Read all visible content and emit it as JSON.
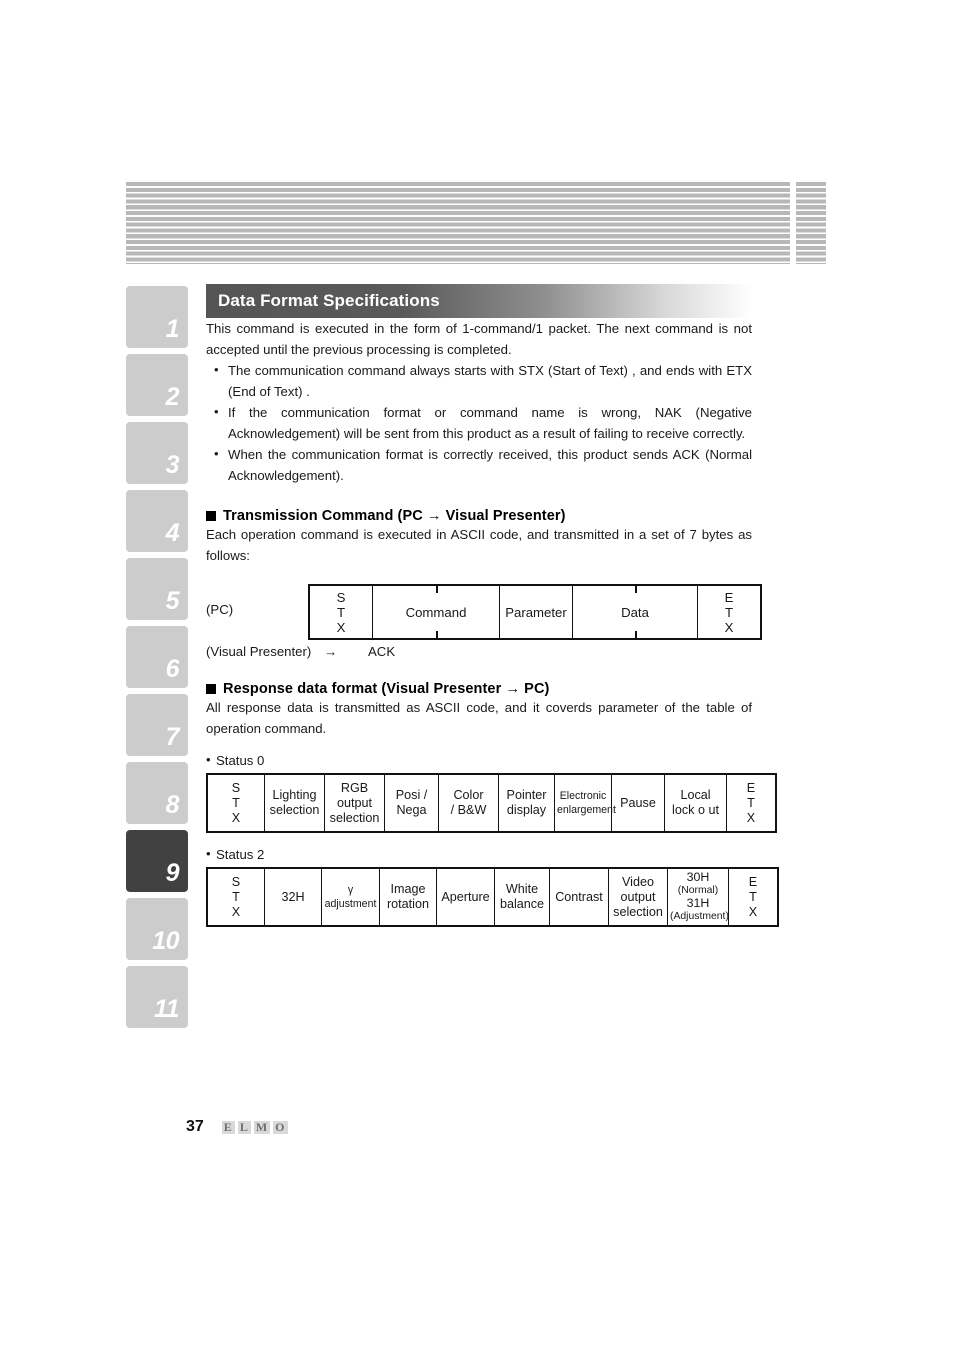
{
  "page": {
    "number": "37",
    "logo_letters": [
      "E",
      "L",
      "M",
      "O"
    ]
  },
  "tab_rail": {
    "active": "9",
    "tabs": [
      "1",
      "2",
      "3",
      "4",
      "5",
      "6",
      "7",
      "8",
      "9",
      "10",
      "11"
    ]
  },
  "section": {
    "title": "Data Format Specifications"
  },
  "intro": {
    "paragraph": "This command is executed in the form of 1-command/1 packet.  The next command is not accepted until the previous processing is completed.",
    "bullets": [
      "The communication command always starts with STX (Start of Text) , and ends with ETX (End of Text) .",
      "If the communication format or command name is wrong, NAK (Negative Acknowledgement) will be sent from this product as a result of failing to receive correctly.",
      "When the communication format is correctly received, this product sends ACK (Normal Acknowledgement)."
    ]
  },
  "transmission": {
    "heading": "Transmission Command (PC → Visual Presenter)",
    "description": "Each operation command is executed in ASCII code, and transmitted in a set of 7 bytes as follows:",
    "pc_label": "(PC)",
    "table_cells": [
      {
        "lines": [
          "S",
          "T",
          "X"
        ],
        "split": false
      },
      {
        "lines": [
          "Command"
        ],
        "split": true
      },
      {
        "lines": [
          "Parameter"
        ],
        "split": false
      },
      {
        "lines": [
          "Data"
        ],
        "split": true
      },
      {
        "lines": [
          "E",
          "T",
          "X"
        ],
        "split": false
      }
    ],
    "ack_row": {
      "source": "(Visual Presenter)",
      "arrow": "→",
      "value": "ACK"
    }
  },
  "response": {
    "heading": "Response data format (Visual Presenter → PC)",
    "description": "All response data is transmitted as ASCII code, and it coverds parameter of the table of operation command.",
    "status0": {
      "label": "Status 0",
      "cells": [
        {
          "lines": [
            "S",
            "T",
            "X"
          ],
          "size": "normal"
        },
        {
          "lines": [
            "Lighting",
            "selection"
          ],
          "size": "normal"
        },
        {
          "lines": [
            "RGB",
            "output",
            "selection"
          ],
          "size": "normal"
        },
        {
          "lines": [
            "Posi /",
            "Nega"
          ],
          "size": "normal"
        },
        {
          "lines": [
            "Color",
            "/    B&W"
          ],
          "size": "normal"
        },
        {
          "lines": [
            "Pointer",
            "display"
          ],
          "size": "normal"
        },
        {
          "lines": [
            "Electronic",
            "enlargement"
          ],
          "size": "tight"
        },
        {
          "lines": [
            "Pause"
          ],
          "size": "normal"
        },
        {
          "lines": [
            "Local",
            "lock o ut"
          ],
          "size": "normal"
        },
        {
          "lines": [
            "E",
            "T",
            "X"
          ],
          "size": "normal"
        }
      ]
    },
    "status2": {
      "label": "Status 2",
      "cells": [
        {
          "lines": [
            "S",
            "T",
            "X"
          ],
          "size": "normal"
        },
        {
          "lines": [
            "32H"
          ],
          "size": "normal"
        },
        {
          "lines": [
            "γ",
            "adjustment"
          ],
          "size": "tight"
        },
        {
          "lines": [
            "Image",
            "rotation"
          ],
          "size": "normal"
        },
        {
          "lines": [
            "Aperture"
          ],
          "size": "normal"
        },
        {
          "lines": [
            "White",
            "balance"
          ],
          "size": "normal"
        },
        {
          "lines": [
            "Contrast"
          ],
          "size": "normal"
        },
        {
          "lines": [
            "Video",
            "output",
            "selection"
          ],
          "size": "normal"
        },
        {
          "lines": [
            "30H",
            "(Normal)",
            "31H",
            "(Adjustment)"
          ],
          "size": "two-line"
        },
        {
          "lines": [
            "E",
            "T",
            "X"
          ],
          "size": "normal"
        }
      ]
    }
  }
}
